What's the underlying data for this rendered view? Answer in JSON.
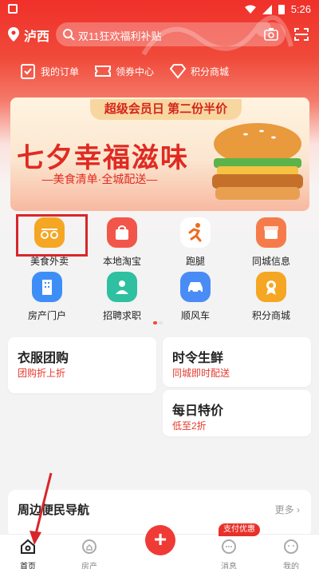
{
  "status_bar": {
    "time": "5:26"
  },
  "topbar": {
    "city": "泸西",
    "search_text": "双11狂欢福利补贴"
  },
  "quick_links": [
    {
      "label": "我的订单",
      "icon": "order-icon"
    },
    {
      "label": "领券中心",
      "icon": "coupon-icon"
    },
    {
      "label": "积分商城",
      "icon": "diamond-icon"
    }
  ],
  "banner": {
    "pill": "超级会员日 第二份半价",
    "title": "七夕幸福滋味",
    "subtitle": "—美食清单·全城配送—"
  },
  "categories": [
    {
      "label": "美食外卖",
      "icon": "food-delivery-icon",
      "color": "#f5a623"
    },
    {
      "label": "本地淘宝",
      "icon": "shopping-bag-icon",
      "color": "#f2564a"
    },
    {
      "label": "跑腿",
      "icon": "runner-icon",
      "color": "#ffffff"
    },
    {
      "label": "同城信息",
      "icon": "box-icon",
      "color": "#f57c4a"
    },
    {
      "label": "房产门户",
      "icon": "building-icon",
      "color": "#3e8ef7"
    },
    {
      "label": "招聘求职",
      "icon": "person-icon",
      "color": "#2ec0a0"
    },
    {
      "label": "顺风车",
      "icon": "car-icon",
      "color": "#4a8cf5"
    },
    {
      "label": "积分商城",
      "icon": "award-icon",
      "color": "#f5a623"
    }
  ],
  "cards": [
    {
      "title": "衣服团购",
      "sub": "团购折上折"
    },
    {
      "title": "时令生鲜",
      "sub": "同城即时配送"
    },
    {
      "title": "每日特价",
      "sub": "低至2折"
    }
  ],
  "nearby": {
    "title": "周边便民导航",
    "more": "更多"
  },
  "bottom_nav": {
    "items": [
      {
        "label": "首页",
        "icon": "home-icon"
      },
      {
        "label": "房产",
        "icon": "house-icon"
      },
      {
        "label": "+",
        "icon": "plus-icon"
      },
      {
        "label": "消息",
        "icon": "message-icon"
      },
      {
        "label": "我的",
        "icon": "profile-icon"
      }
    ],
    "pay_badge": "支付优惠"
  },
  "colors": {
    "brand_red": "#f03a36",
    "highlight_box": "#d8262b"
  }
}
